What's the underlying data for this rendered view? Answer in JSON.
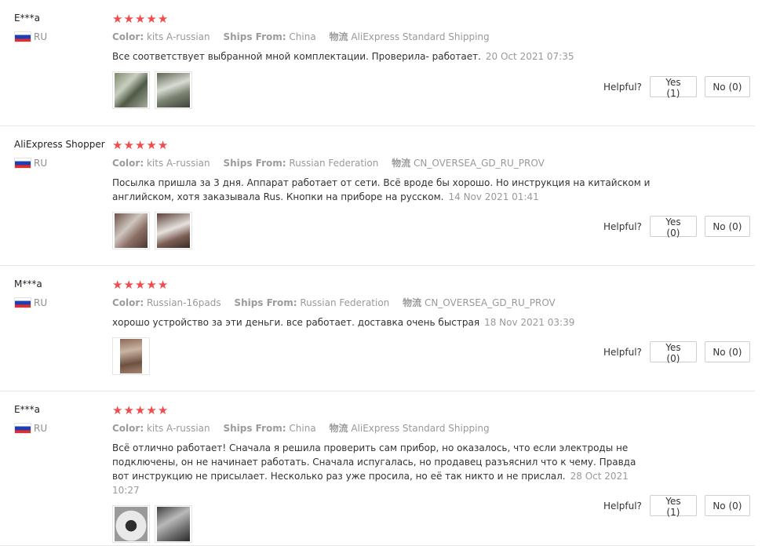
{
  "labels": {
    "color": "Color:",
    "ships_from": "Ships From:",
    "shipping": "物流",
    "helpful": "Helpful?"
  },
  "reviews": [
    {
      "user": "E***a",
      "country": "RU",
      "rating": 5,
      "color": "kits A-russian",
      "ships_from": "China",
      "shipping": "AliExpress Standard Shipping",
      "text": "Все соответствует выбранной мной комплектации. Проверила- работает.",
      "date": "20 Oct 2021 07:35",
      "yes": "Yes (1)",
      "no": "No (0)"
    },
    {
      "user": "AliExpress Shopper",
      "country": "RU",
      "rating": 5,
      "color": "kits A-russian",
      "ships_from": "Russian Federation",
      "shipping": "CN_OVERSEA_GD_RU_PROV",
      "text": "Посылка пришла за 3 дня. Аппарат работает от сети. Всё вроде бы хорошо. Но инструкция на китайском и английском, хотя заказывала Rus. Кнопки на приборе на русском.",
      "date": "14 Nov 2021 01:41",
      "yes": "Yes (0)",
      "no": "No (0)"
    },
    {
      "user": "M***a",
      "country": "RU",
      "rating": 5,
      "color": "Russian-16pads",
      "ships_from": "Russian Federation",
      "shipping": "CN_OVERSEA_GD_RU_PROV",
      "text": "хорошо устройство за эти деньги. все работает. доставка очень быстрая",
      "date": "18 Nov 2021 03:39",
      "yes": "Yes (0)",
      "no": "No (0)"
    },
    {
      "user": "E***a",
      "country": "RU",
      "rating": 5,
      "color": "kits A-russian",
      "ships_from": "China",
      "shipping": "AliExpress Standard Shipping",
      "text": "Всё отлично работает! Сначала я решила проверить сам прибор, но оказалось, что если электроды не подключены, он не начинает работать. Сначала испугалась, но продавец разъяснил что к чему. Правда вот инструкцию не присылает. Несколько раз уже просила, но её так никто и не прислал.",
      "date": "28 Oct 2021 10:27",
      "yes": "Yes (1)",
      "no": "No (0)"
    }
  ],
  "colors": {
    "star": "#f04c4c",
    "muted": "#999999",
    "text": "#333333",
    "flag_white": "#ffffff",
    "flag_blue": "#1c3fb5",
    "flag_red": "#e52b2b"
  },
  "icons": {
    "star": "star-icon",
    "flag": "russia-flag-icon",
    "photo": "review-photo-thumbnail"
  }
}
